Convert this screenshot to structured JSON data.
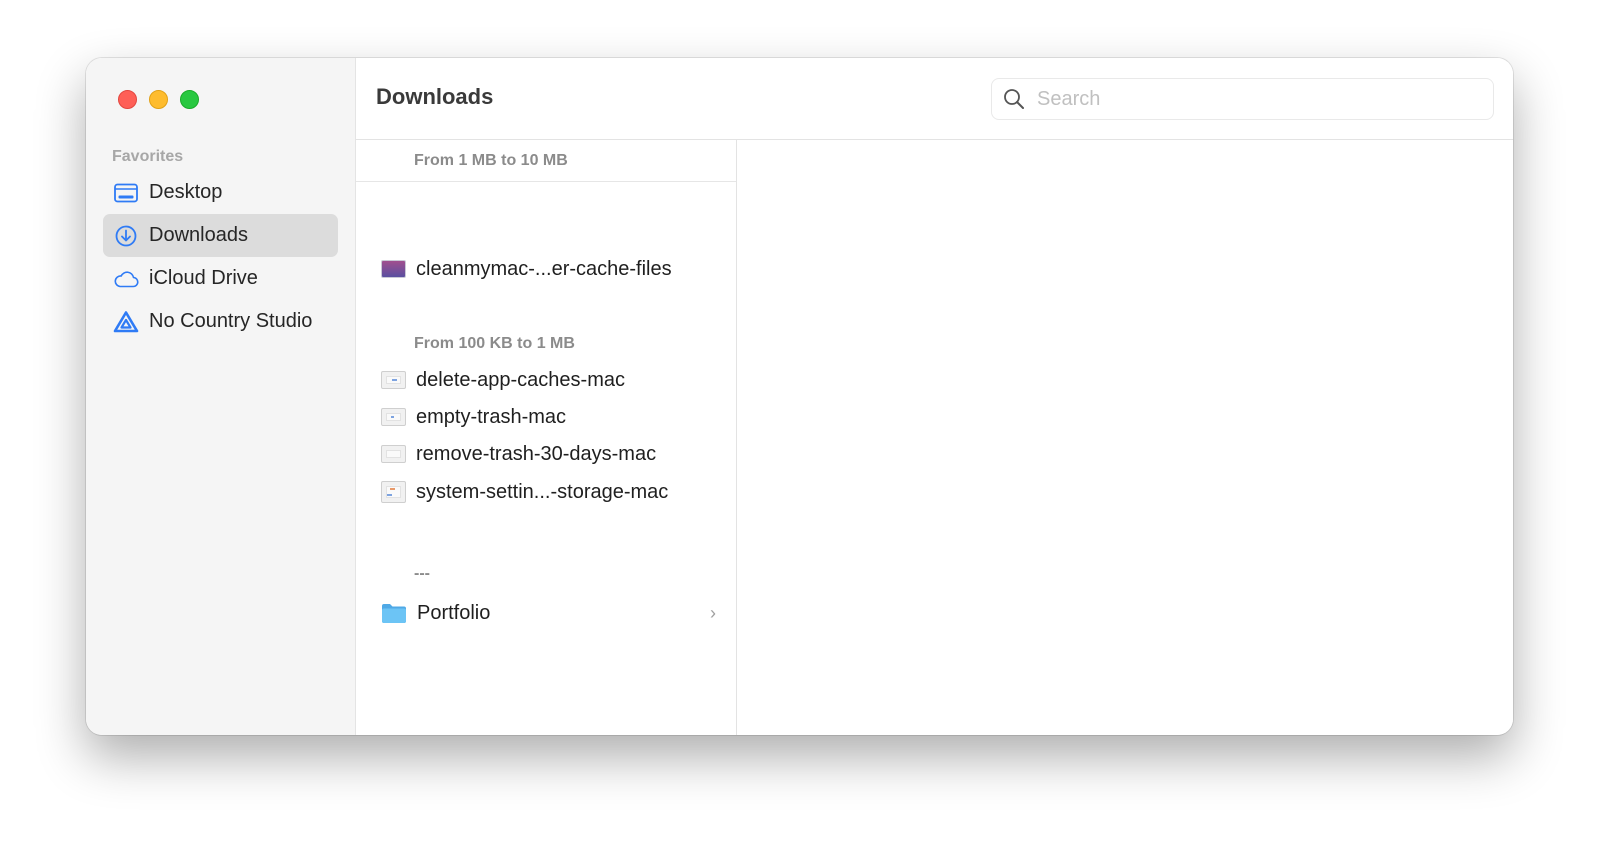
{
  "window": {
    "title": "Downloads",
    "traffic_lights": [
      "close",
      "minimize",
      "zoom"
    ]
  },
  "sidebar": {
    "section_label": "Favorites",
    "items": [
      {
        "label": "Desktop",
        "icon": "desktop-icon",
        "active": false
      },
      {
        "label": "Downloads",
        "icon": "download-circle-icon",
        "active": true
      },
      {
        "label": "iCloud Drive",
        "icon": "cloud-icon",
        "active": false
      },
      {
        "label": "No Country Studio",
        "icon": "shared-drive-triangle-icon",
        "active": false
      }
    ]
  },
  "search": {
    "placeholder": "Search",
    "value": ""
  },
  "column": {
    "groups": [
      {
        "header": "From 1 MB to 10 MB",
        "files": [
          {
            "name": "cleanmymac-...er-cache-files",
            "icon": "image-thumbnail-icon"
          }
        ]
      },
      {
        "header": "From 100 KB to 1 MB",
        "files": [
          {
            "name": "delete-app-caches-mac",
            "icon": "image-thumbnail-icon"
          },
          {
            "name": "empty-trash-mac",
            "icon": "image-thumbnail-icon"
          },
          {
            "name": "remove-trash-30-days-mac",
            "icon": "image-thumbnail-icon"
          },
          {
            "name": "system-settin...-storage-mac",
            "icon": "image-thumbnail-icon"
          }
        ]
      },
      {
        "header": "---",
        "files": [
          {
            "name": "Portfolio",
            "icon": "folder-icon",
            "has_children": true
          }
        ]
      }
    ]
  },
  "colors": {
    "accent": "#2f7bf5",
    "folder": "#5ab8f0",
    "sidebar_bg": "#f5f5f5",
    "selection_bg": "#dcdcdc"
  }
}
